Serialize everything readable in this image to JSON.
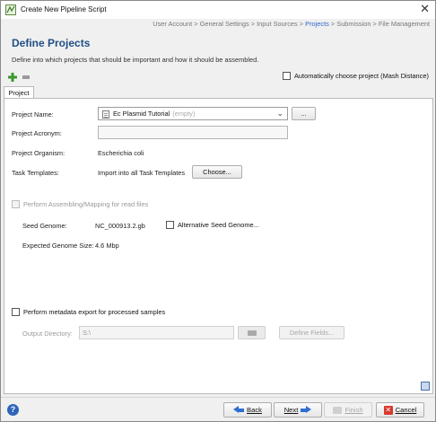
{
  "window": {
    "title": "Create New Pipeline Script",
    "close_glyph": "✕"
  },
  "breadcrumb": {
    "before": "User Account > General Settings > Input Sources > ",
    "active": "Projects",
    "after": " > Submission > File Management"
  },
  "header": {
    "title": "Define Projects",
    "description": "Define into which projects that should be important and how it should be assembled."
  },
  "toolbar": {
    "add_icon": "plus-icon",
    "remove_icon": "minus-icon",
    "auto_choose_label": "Automatically choose project (Mash Distance)",
    "auto_choose_checked": false
  },
  "tabs": [
    {
      "label": "Project"
    }
  ],
  "form": {
    "project_name_label": "Project Name:",
    "project_name_value": "Ec Plasmid Tutorial",
    "project_name_suffix": "(empty)",
    "browse_label": "...",
    "project_acronym_label": "Project Acronym:",
    "project_acronym_value": "",
    "project_organism_label": "Project Organism:",
    "project_organism_value": "Escherichia coli",
    "task_templates_label": "Task Templates:",
    "task_templates_value": "Import into all Task Templates",
    "choose_label": "Choose..."
  },
  "assembly": {
    "perform_label": "Perform Assembling/Mapping for read files",
    "seed_genome_label": "Seed Genome:",
    "seed_genome_value": "NC_000913.2.gb",
    "alt_seed_label": "Alternative Seed Genome...",
    "expected_size_label": "Expected Genome Size:",
    "expected_size_value": "4.6 Mbp"
  },
  "metadata": {
    "perform_label": "Perform metadata export for processed samples",
    "output_dir_label": "Output Directory:",
    "output_dir_value": "S:\\",
    "define_fields_label": "Define Fields..."
  },
  "footer": {
    "help_glyph": "?",
    "back_label": "Back",
    "next_label": "Next",
    "finish_label": "Finish",
    "cancel_label": "Cancel"
  },
  "colors": {
    "title": "#1f4f86",
    "active_crumb": "#3366cc",
    "arrow": "#2f6fd3",
    "cancel": "#d83a2e"
  }
}
